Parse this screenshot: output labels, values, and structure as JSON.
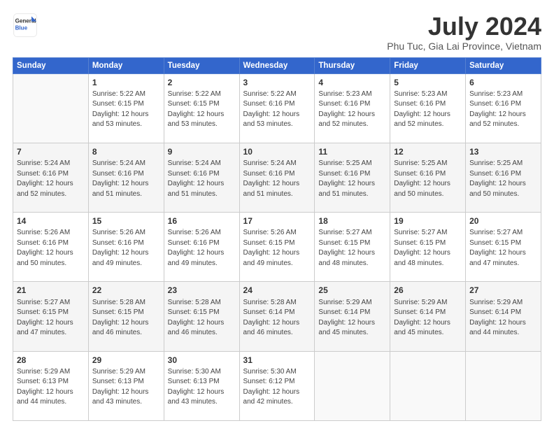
{
  "logo": {
    "line1": "General",
    "line2": "Blue"
  },
  "title": "July 2024",
  "subtitle": "Phu Tuc, Gia Lai Province, Vietnam",
  "days_of_week": [
    "Sunday",
    "Monday",
    "Tuesday",
    "Wednesday",
    "Thursday",
    "Friday",
    "Saturday"
  ],
  "weeks": [
    [
      {
        "day": "",
        "sunrise": "",
        "sunset": "",
        "daylight": "",
        "minutes": ""
      },
      {
        "day": "1",
        "sunrise": "5:22 AM",
        "sunset": "6:15 PM",
        "daylight": "12 hours",
        "minutes": "and 53 minutes."
      },
      {
        "day": "2",
        "sunrise": "5:22 AM",
        "sunset": "6:15 PM",
        "daylight": "12 hours",
        "minutes": "and 53 minutes."
      },
      {
        "day": "3",
        "sunrise": "5:22 AM",
        "sunset": "6:16 PM",
        "daylight": "12 hours",
        "minutes": "and 53 minutes."
      },
      {
        "day": "4",
        "sunrise": "5:23 AM",
        "sunset": "6:16 PM",
        "daylight": "12 hours",
        "minutes": "and 52 minutes."
      },
      {
        "day": "5",
        "sunrise": "5:23 AM",
        "sunset": "6:16 PM",
        "daylight": "12 hours",
        "minutes": "and 52 minutes."
      },
      {
        "day": "6",
        "sunrise": "5:23 AM",
        "sunset": "6:16 PM",
        "daylight": "12 hours",
        "minutes": "and 52 minutes."
      }
    ],
    [
      {
        "day": "7",
        "sunrise": "5:24 AM",
        "sunset": "6:16 PM",
        "daylight": "12 hours",
        "minutes": "and 52 minutes."
      },
      {
        "day": "8",
        "sunrise": "5:24 AM",
        "sunset": "6:16 PM",
        "daylight": "12 hours",
        "minutes": "and 51 minutes."
      },
      {
        "day": "9",
        "sunrise": "5:24 AM",
        "sunset": "6:16 PM",
        "daylight": "12 hours",
        "minutes": "and 51 minutes."
      },
      {
        "day": "10",
        "sunrise": "5:24 AM",
        "sunset": "6:16 PM",
        "daylight": "12 hours",
        "minutes": "and 51 minutes."
      },
      {
        "day": "11",
        "sunrise": "5:25 AM",
        "sunset": "6:16 PM",
        "daylight": "12 hours",
        "minutes": "and 51 minutes."
      },
      {
        "day": "12",
        "sunrise": "5:25 AM",
        "sunset": "6:16 PM",
        "daylight": "12 hours",
        "minutes": "and 50 minutes."
      },
      {
        "day": "13",
        "sunrise": "5:25 AM",
        "sunset": "6:16 PM",
        "daylight": "12 hours",
        "minutes": "and 50 minutes."
      }
    ],
    [
      {
        "day": "14",
        "sunrise": "5:26 AM",
        "sunset": "6:16 PM",
        "daylight": "12 hours",
        "minutes": "and 50 minutes."
      },
      {
        "day": "15",
        "sunrise": "5:26 AM",
        "sunset": "6:16 PM",
        "daylight": "12 hours",
        "minutes": "and 49 minutes."
      },
      {
        "day": "16",
        "sunrise": "5:26 AM",
        "sunset": "6:16 PM",
        "daylight": "12 hours",
        "minutes": "and 49 minutes."
      },
      {
        "day": "17",
        "sunrise": "5:26 AM",
        "sunset": "6:15 PM",
        "daylight": "12 hours",
        "minutes": "and 49 minutes."
      },
      {
        "day": "18",
        "sunrise": "5:27 AM",
        "sunset": "6:15 PM",
        "daylight": "12 hours",
        "minutes": "and 48 minutes."
      },
      {
        "day": "19",
        "sunrise": "5:27 AM",
        "sunset": "6:15 PM",
        "daylight": "12 hours",
        "minutes": "and 48 minutes."
      },
      {
        "day": "20",
        "sunrise": "5:27 AM",
        "sunset": "6:15 PM",
        "daylight": "12 hours",
        "minutes": "and 47 minutes."
      }
    ],
    [
      {
        "day": "21",
        "sunrise": "5:27 AM",
        "sunset": "6:15 PM",
        "daylight": "12 hours",
        "minutes": "and 47 minutes."
      },
      {
        "day": "22",
        "sunrise": "5:28 AM",
        "sunset": "6:15 PM",
        "daylight": "12 hours",
        "minutes": "and 46 minutes."
      },
      {
        "day": "23",
        "sunrise": "5:28 AM",
        "sunset": "6:15 PM",
        "daylight": "12 hours",
        "minutes": "and 46 minutes."
      },
      {
        "day": "24",
        "sunrise": "5:28 AM",
        "sunset": "6:14 PM",
        "daylight": "12 hours",
        "minutes": "and 46 minutes."
      },
      {
        "day": "25",
        "sunrise": "5:29 AM",
        "sunset": "6:14 PM",
        "daylight": "12 hours",
        "minutes": "and 45 minutes."
      },
      {
        "day": "26",
        "sunrise": "5:29 AM",
        "sunset": "6:14 PM",
        "daylight": "12 hours",
        "minutes": "and 45 minutes."
      },
      {
        "day": "27",
        "sunrise": "5:29 AM",
        "sunset": "6:14 PM",
        "daylight": "12 hours",
        "minutes": "and 44 minutes."
      }
    ],
    [
      {
        "day": "28",
        "sunrise": "5:29 AM",
        "sunset": "6:13 PM",
        "daylight": "12 hours",
        "minutes": "and 44 minutes."
      },
      {
        "day": "29",
        "sunrise": "5:29 AM",
        "sunset": "6:13 PM",
        "daylight": "12 hours",
        "minutes": "and 43 minutes."
      },
      {
        "day": "30",
        "sunrise": "5:30 AM",
        "sunset": "6:13 PM",
        "daylight": "12 hours",
        "minutes": "and 43 minutes."
      },
      {
        "day": "31",
        "sunrise": "5:30 AM",
        "sunset": "6:12 PM",
        "daylight": "12 hours",
        "minutes": "and 42 minutes."
      },
      {
        "day": "",
        "sunrise": "",
        "sunset": "",
        "daylight": "",
        "minutes": ""
      },
      {
        "day": "",
        "sunrise": "",
        "sunset": "",
        "daylight": "",
        "minutes": ""
      },
      {
        "day": "",
        "sunrise": "",
        "sunset": "",
        "daylight": "",
        "minutes": ""
      }
    ]
  ]
}
